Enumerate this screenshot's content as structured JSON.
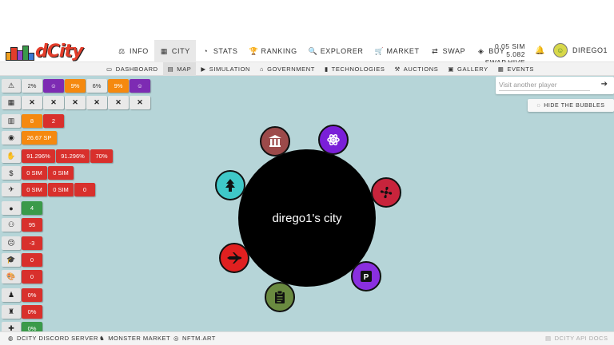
{
  "brand": {
    "name": "dCity"
  },
  "nav": [
    {
      "label": "INFO",
      "icon": "scale-icon",
      "glyph": "⚖"
    },
    {
      "label": "CITY",
      "icon": "city-icon",
      "glyph": "▦"
    },
    {
      "label": "STATS",
      "icon": "pie-chart-icon",
      "glyph": "◔"
    },
    {
      "label": "RANKING",
      "icon": "trophy-icon",
      "glyph": "🏆"
    },
    {
      "label": "EXPLORER",
      "icon": "search-icon",
      "glyph": "🔍"
    },
    {
      "label": "MARKET",
      "icon": "cart-icon",
      "glyph": "🛒"
    },
    {
      "label": "SWAP",
      "icon": "swap-icon",
      "glyph": "⇄"
    },
    {
      "label": "BUY",
      "icon": "coins-icon",
      "glyph": "◈"
    }
  ],
  "balance": {
    "sim": "0.05 SIM",
    "swap": "5.082 SWAP.HIVE"
  },
  "user": {
    "name": "DIREGO1"
  },
  "subnav": [
    {
      "label": "DASHBOARD",
      "glyph": "▭"
    },
    {
      "label": "MAP",
      "glyph": "▤"
    },
    {
      "label": "SIMULATION",
      "glyph": "▶"
    },
    {
      "label": "GOVERNMENT",
      "glyph": "⌂"
    },
    {
      "label": "TECHNOLOGIES",
      "glyph": "▮"
    },
    {
      "label": "AUCTIONS",
      "glyph": "⚒"
    },
    {
      "label": "GALLERY",
      "glyph": "▣"
    },
    {
      "label": "EVENTS",
      "glyph": "▦"
    }
  ],
  "search": {
    "placeholder": "Visit another player"
  },
  "hide_bubbles": {
    "label": "HIDE THE BUBBLES"
  },
  "city": {
    "title": "dirego1's city"
  },
  "stats": {
    "row1": [
      "2%",
      "☺",
      "9%",
      "6%",
      "9%",
      "☺"
    ],
    "row2": [
      "✕",
      "✕",
      "✕",
      "✕",
      "✕",
      "✕"
    ],
    "row3": [
      "8",
      "2"
    ],
    "row4": [
      "26.67 SP"
    ],
    "row5": [
      "91.296%",
      "91.296%",
      "70%"
    ],
    "row6": [
      "0 SIM",
      "0 SIM"
    ],
    "row7": [
      "0 SIM",
      "0 SIM",
      "0"
    ],
    "row8": [
      "4"
    ],
    "row9": [
      "95"
    ],
    "row10": [
      "-3"
    ],
    "row11": [
      "0"
    ],
    "row12": [
      "0"
    ],
    "row13": [
      "0%"
    ],
    "row14": [
      "0%"
    ],
    "row15": [
      "0%"
    ]
  },
  "footer": {
    "discord": "DCITY DISCORD SERVER",
    "monster": "MONSTER MARKET",
    "nftm": "NFTM.ART",
    "api": "DCITY API DOCS"
  },
  "colors": {
    "map_bg": "#b6d5d8",
    "red": "#d8302c",
    "orange": "#f5890f",
    "purple": "#7d2bb3",
    "green": "#3a9a4a"
  }
}
